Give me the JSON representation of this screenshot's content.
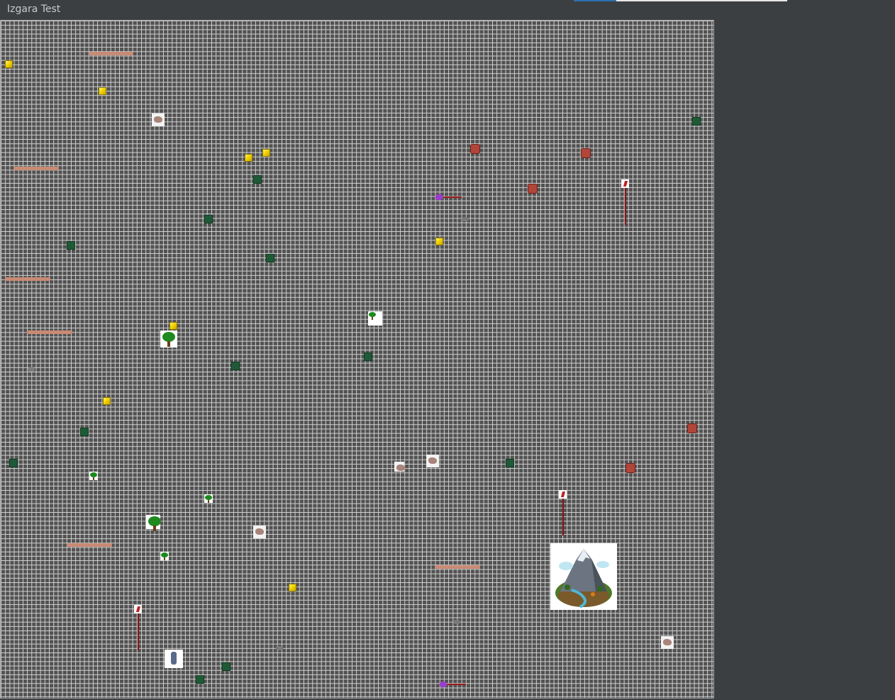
{
  "window": {
    "title": "Izgara Test"
  },
  "colors": {
    "background": "#3c3f41",
    "grid_fill": "#525252",
    "grid_line": "#d4d4d4",
    "gold": "#f3d400",
    "bush": "#1f5a36",
    "wall": "#c98a74",
    "red_rock": "#b0453a"
  },
  "entities": {
    "gold": "gold-block-icon",
    "bush": "dark-bush-icon",
    "wall": "wall-segment",
    "rock": "rock-icon",
    "red_rock": "red-rock-icon",
    "tree": "tree-icon",
    "wolf": "wolf-icon",
    "flag": "flag-icon",
    "bug": "purple-creature-icon",
    "knight": "knight-icon",
    "mountain": "mountain-island-icon"
  }
}
